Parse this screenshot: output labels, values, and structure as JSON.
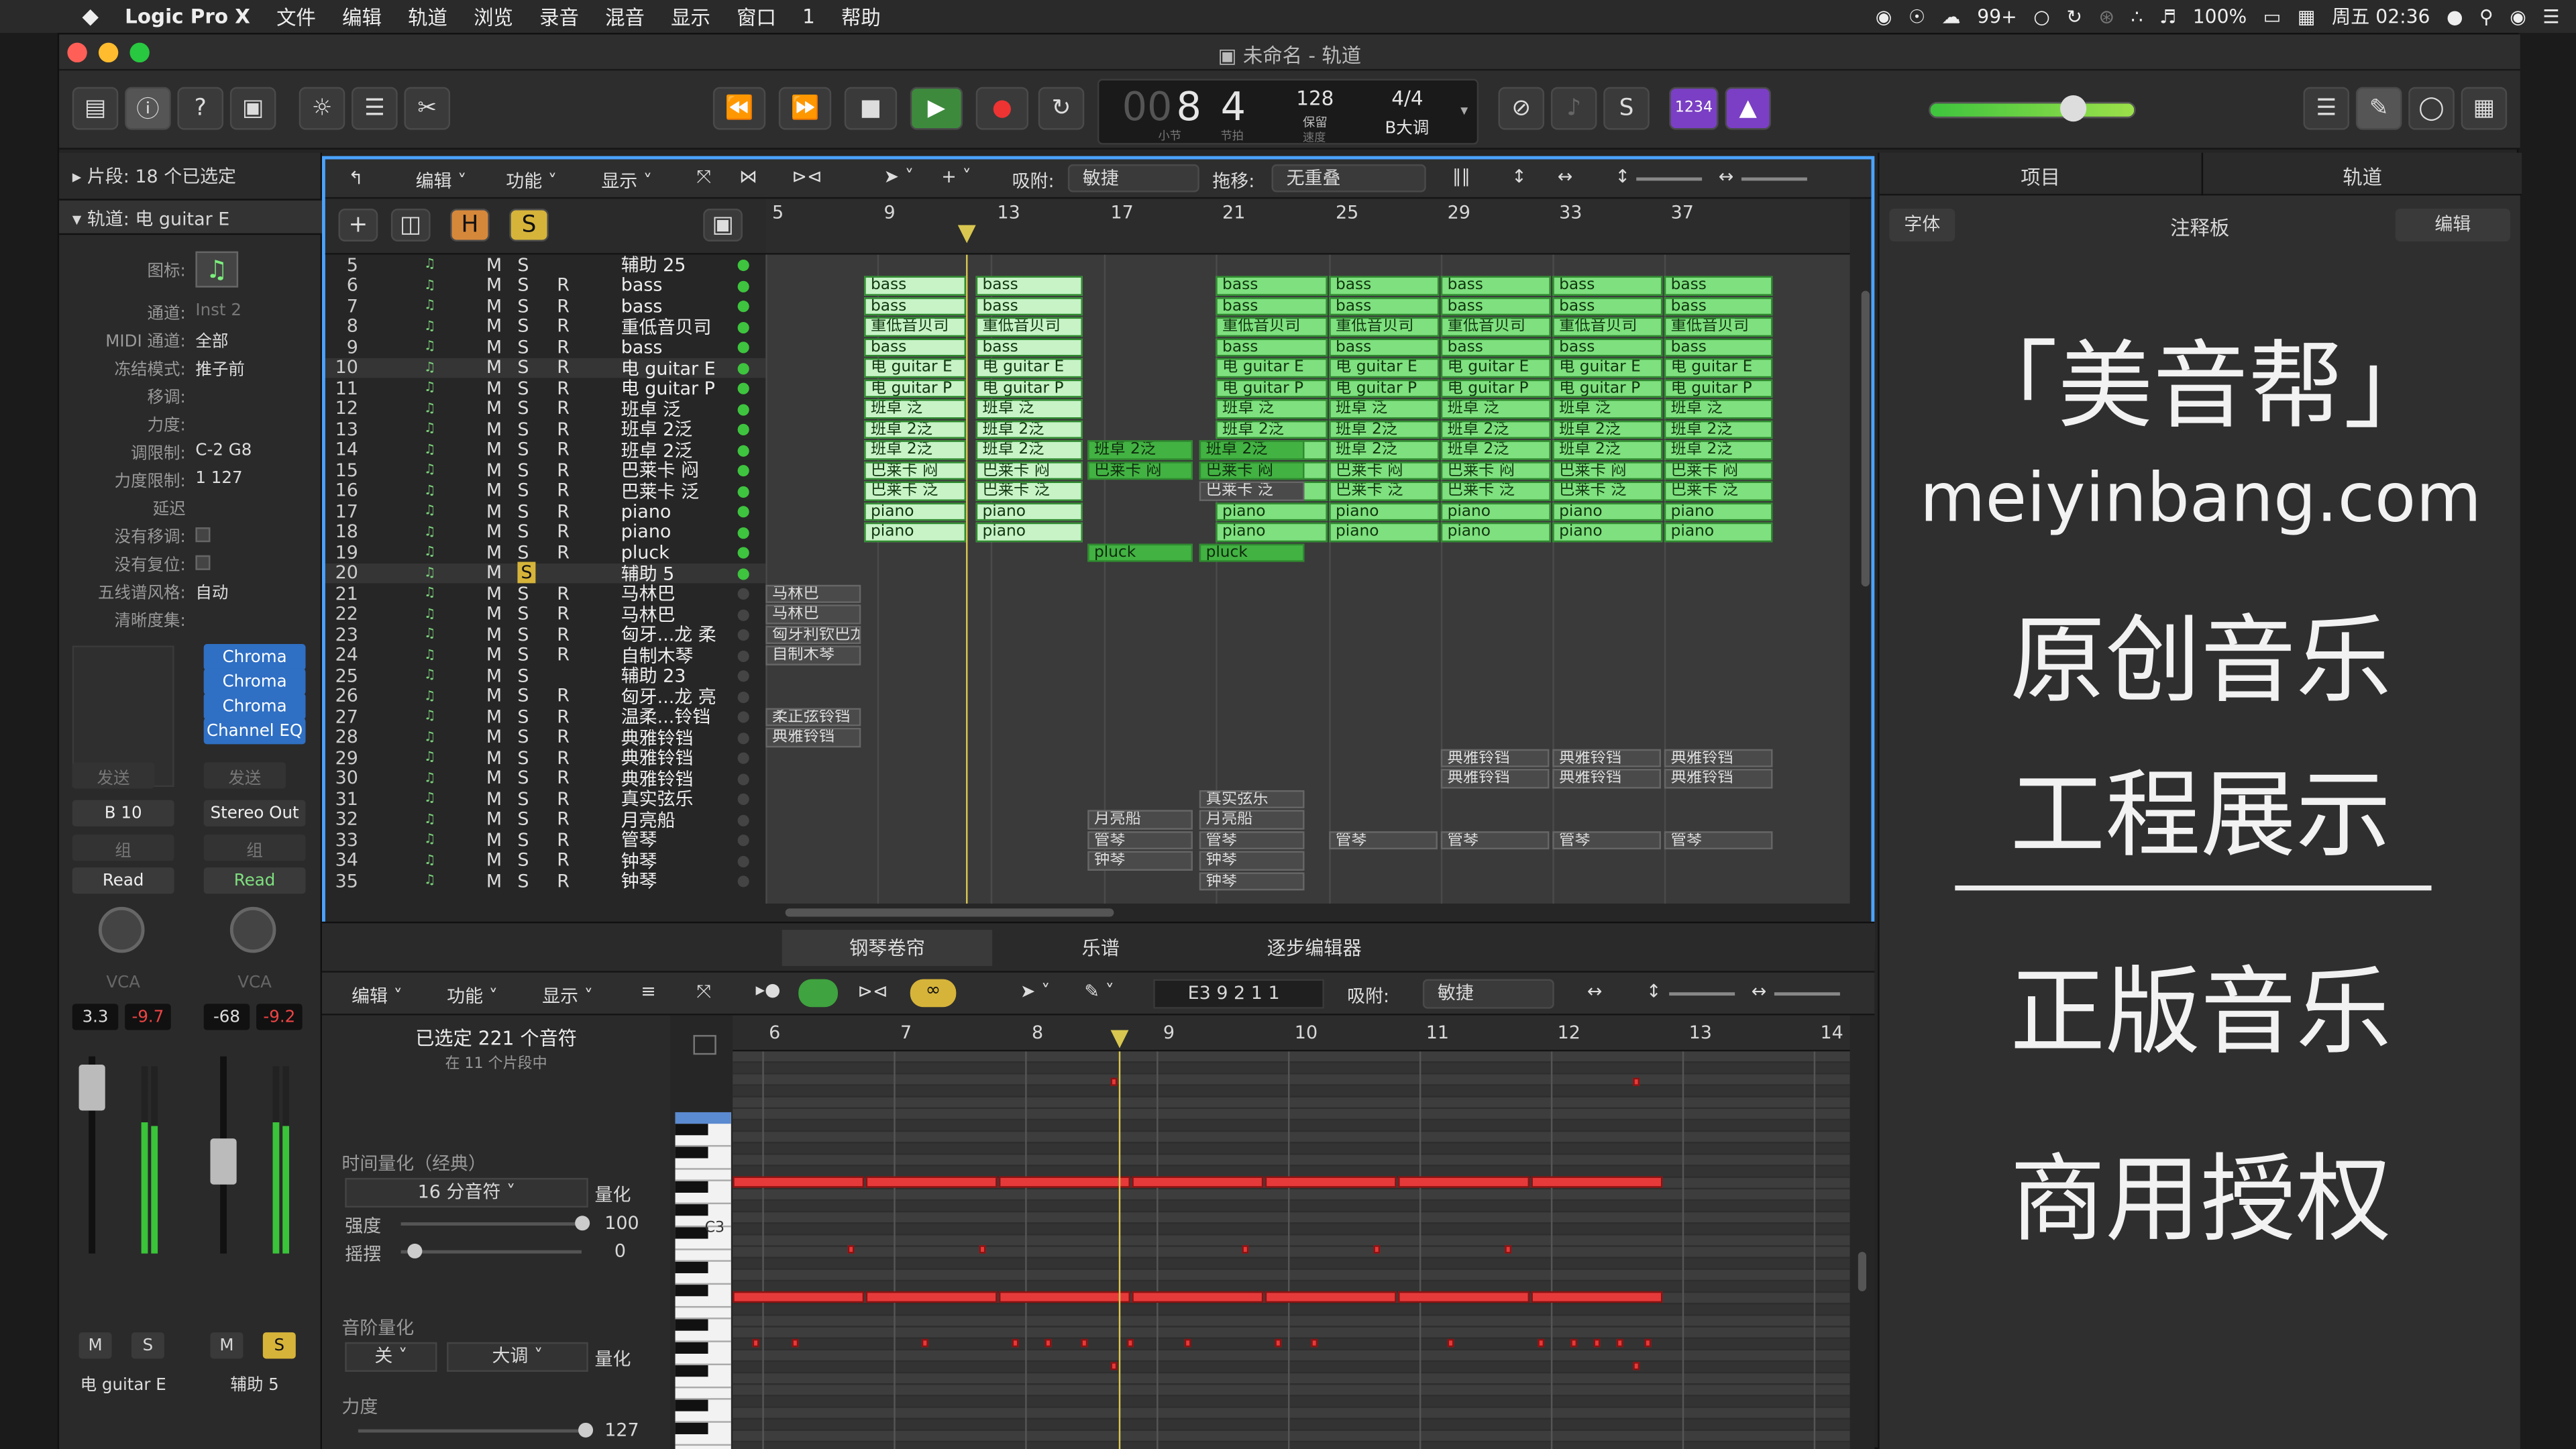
{
  "menubar": {
    "app": "Logic Pro X",
    "items": [
      "文件",
      "编辑",
      "轨道",
      "浏览",
      "录音",
      "混音",
      "显示",
      "窗口",
      "1",
      "帮助"
    ],
    "status": {
      "wechat_count": "99+",
      "battery": "100%",
      "datetime": "周五 02:36"
    }
  },
  "window": {
    "title": "未命名 - 轨道"
  },
  "lcd": {
    "bar": "8",
    "beat": "4",
    "bar_label": "小节",
    "beat_label": "节拍",
    "tempo": "128",
    "tempo_label": "保留",
    "tempo_sub": "速度",
    "sig": "4/4",
    "key": "B大调",
    "count_in": "1234"
  },
  "inspector": {
    "regions_label": "片段: 18 个已选定",
    "track_label": "轨道: 电 guitar E",
    "rows": [
      {
        "k": "图标:",
        "v": ""
      },
      {
        "k": "通道:",
        "v": "Inst 2"
      },
      {
        "k": "MIDI 通道:",
        "v": "全部"
      },
      {
        "k": "冻结模式:",
        "v": "推子前"
      },
      {
        "k": "移调:",
        "v": ""
      },
      {
        "k": "力度:",
        "v": ""
      },
      {
        "k": "调限制:",
        "v": "C-2 G8"
      },
      {
        "k": "力度限制:",
        "v": "1 127"
      },
      {
        "k": "延迟",
        "v": ""
      },
      {
        "k": "没有移调:",
        "v": ""
      },
      {
        "k": "没有复位:",
        "v": ""
      },
      {
        "k": "五线谱风格:",
        "v": "自动"
      },
      {
        "k": "清晰度集:",
        "v": ""
      }
    ],
    "plugins": [
      "Chroma",
      "Chroma",
      "Chroma",
      "Channel EQ"
    ],
    "strip1": {
      "send": "发送",
      "output": "B 10",
      "group": "组",
      "auto": "Read",
      "vca": "VCA",
      "vol": "3.3",
      "peak": "-9.7",
      "name": "电 guitar E",
      "m": "M",
      "s": "S"
    },
    "strip2": {
      "send": "发送",
      "output": "Stereo Out",
      "group": "组",
      "auto": "Read",
      "vca": "VCA",
      "vol": "-68",
      "peak": "-9.2",
      "name": "辅助 5",
      "m": "M",
      "s": "S"
    }
  },
  "arrange": {
    "menus": [
      "编辑",
      "功能",
      "显示"
    ],
    "snap_label": "吸附:",
    "snap": "敏捷",
    "drag_label": "拖移:",
    "drag": "无重叠",
    "header_btns": {
      "h": "H",
      "s": "S"
    },
    "ruler": [
      "5",
      "9",
      "13",
      "17",
      "21",
      "25",
      "29",
      "33",
      "37"
    ],
    "tracks": [
      {
        "n": "5",
        "name": "辅助 25",
        "r": false
      },
      {
        "n": "6",
        "name": "bass",
        "r": true
      },
      {
        "n": "7",
        "name": "bass",
        "r": true
      },
      {
        "n": "8",
        "name": "重低音贝司",
        "r": true
      },
      {
        "n": "9",
        "name": "bass",
        "r": true
      },
      {
        "n": "10",
        "name": "电 guitar E",
        "r": true
      },
      {
        "n": "11",
        "name": "电 guitar P",
        "r": true
      },
      {
        "n": "12",
        "name": "班卓 泛",
        "r": true
      },
      {
        "n": "13",
        "name": "班卓 2泛",
        "r": true
      },
      {
        "n": "14",
        "name": "班卓 2泛",
        "r": true
      },
      {
        "n": "15",
        "name": "巴莱卡 闷",
        "r": true
      },
      {
        "n": "16",
        "name": "巴莱卡 泛",
        "r": true
      },
      {
        "n": "17",
        "name": "piano",
        "r": true
      },
      {
        "n": "18",
        "name": "piano",
        "r": true
      },
      {
        "n": "19",
        "name": "pluck",
        "r": true
      },
      {
        "n": "20",
        "name": "辅助 5",
        "r": false
      },
      {
        "n": "21",
        "name": "马林巴",
        "r": true
      },
      {
        "n": "22",
        "name": "马林巴",
        "r": true
      },
      {
        "n": "23",
        "name": "匈牙...龙 柔",
        "r": true
      },
      {
        "n": "24",
        "name": "自制木琴",
        "r": true
      },
      {
        "n": "25",
        "name": "辅助 23",
        "r": false
      },
      {
        "n": "26",
        "name": "匈牙...龙 亮",
        "r": true
      },
      {
        "n": "27",
        "name": "温柔...铃铛",
        "r": true
      },
      {
        "n": "28",
        "name": "典雅铃铛",
        "r": true
      },
      {
        "n": "29",
        "name": "典雅铃铛",
        "r": true
      },
      {
        "n": "30",
        "name": "典雅铃铛",
        "r": true
      },
      {
        "n": "31",
        "name": "真实弦乐",
        "r": true
      },
      {
        "n": "32",
        "name": "月亮船",
        "r": true
      },
      {
        "n": "33",
        "name": "管琴",
        "r": true
      },
      {
        "n": "34",
        "name": "钟琴",
        "r": true
      },
      {
        "n": "35",
        "name": "钟琴",
        "r": true
      }
    ],
    "region_names": {
      "bass": "bass",
      "bass2": "重低音贝司",
      "ge": "电 guitar E",
      "gp": "电 guitar P",
      "bz": "班卓 泛",
      "bz2": "班卓 2泛",
      "blm": "巴莱卡 闷",
      "blf": "巴莱卡 泛",
      "pn": "piano",
      "pl": "pluck",
      "mlb": "马林巴",
      "xya": "匈牙利钦巴龙",
      "zzm": "自制木琴",
      "wrl": "柔正弦铃铛",
      "dyl": "典雅铃铛",
      "sxy": "真实弦乐",
      "ylc": "月亮船",
      "gq": "管琴",
      "zq": "钟琴"
    }
  },
  "rightpanel": {
    "tabs": [
      "项目",
      "轨道"
    ],
    "subtabs": [
      "字体",
      "注释板",
      "编辑"
    ],
    "lines": [
      "「美音帮」",
      "meiyinbang.com",
      "原创音乐",
      "工程展示",
      "正版音乐",
      "商用授权"
    ]
  },
  "editor": {
    "tabs": [
      "钢琴卷帘",
      "乐谱",
      "逐步编辑器"
    ],
    "menus": [
      "编辑",
      "功能",
      "显示"
    ],
    "position": "E3  9 2 1 1",
    "snap_label": "吸附:",
    "snap": "敏捷",
    "selected": "已选定 221 个音符",
    "selected_sub": "在 11 个片段中",
    "tq_label": "时间量化（经典）",
    "tq_value": "16 分音符",
    "quantize": "量化",
    "strength_label": "强度",
    "strength": "100",
    "swing_label": "摇摆",
    "swing": "0",
    "sq_label": "音阶量化",
    "sq_off": "关",
    "sq_scale": "大调",
    "vel_label": "力度",
    "vel": "127",
    "ruler": [
      "6",
      "7",
      "8",
      "9",
      "10",
      "11",
      "12",
      "13",
      "14"
    ],
    "c3": "C3"
  }
}
